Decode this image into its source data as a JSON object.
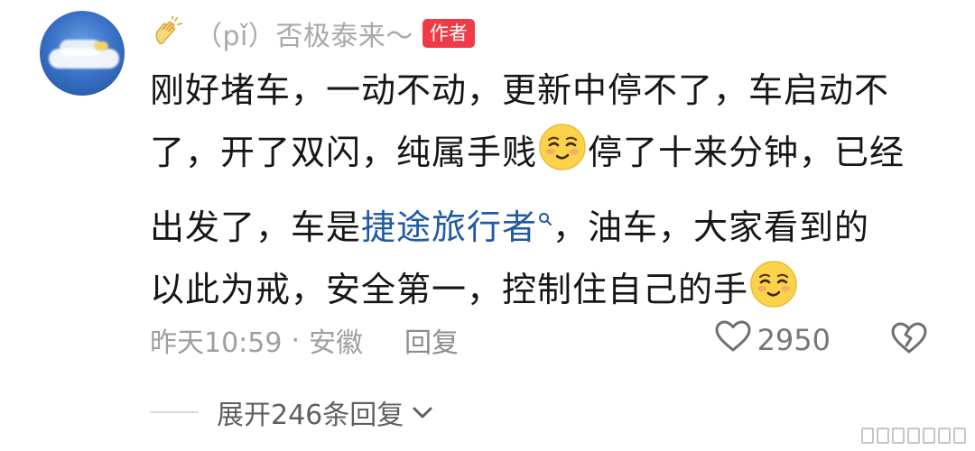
{
  "comment": {
    "username": "（pǐ）否极泰来～",
    "author_badge": "作者",
    "text_segments": {
      "line1": "刚好堵车，一动不动，更新中停不了，车启动不",
      "line2a": "了，开了双闪，纯属手贱",
      "line2b": "停了十来分钟，已经",
      "line3a": "出发了，车是",
      "link": "捷途旅行者",
      "line3b": "，油车，大家看到的",
      "line4": "以此为戒，安全第一，控制住自己的手"
    },
    "time": "昨天10:59",
    "separator": "·",
    "location": "安徽",
    "reply_label": "回复",
    "like_count": "2950",
    "expand_label": "展开246条回复"
  },
  "icons": {
    "header": "clap-icon",
    "emoji": "smirk-emoji-icon",
    "link_suffix": "search-icon",
    "like": "heart-icon",
    "dislike": "broken-heart-icon",
    "expand": "chevron-down-icon"
  },
  "colors": {
    "author_badge": "#ef3a48",
    "link": "#1f5aa8",
    "username": "#a9a9a9",
    "body": "#161616",
    "meta": "#9f9f9f"
  }
}
